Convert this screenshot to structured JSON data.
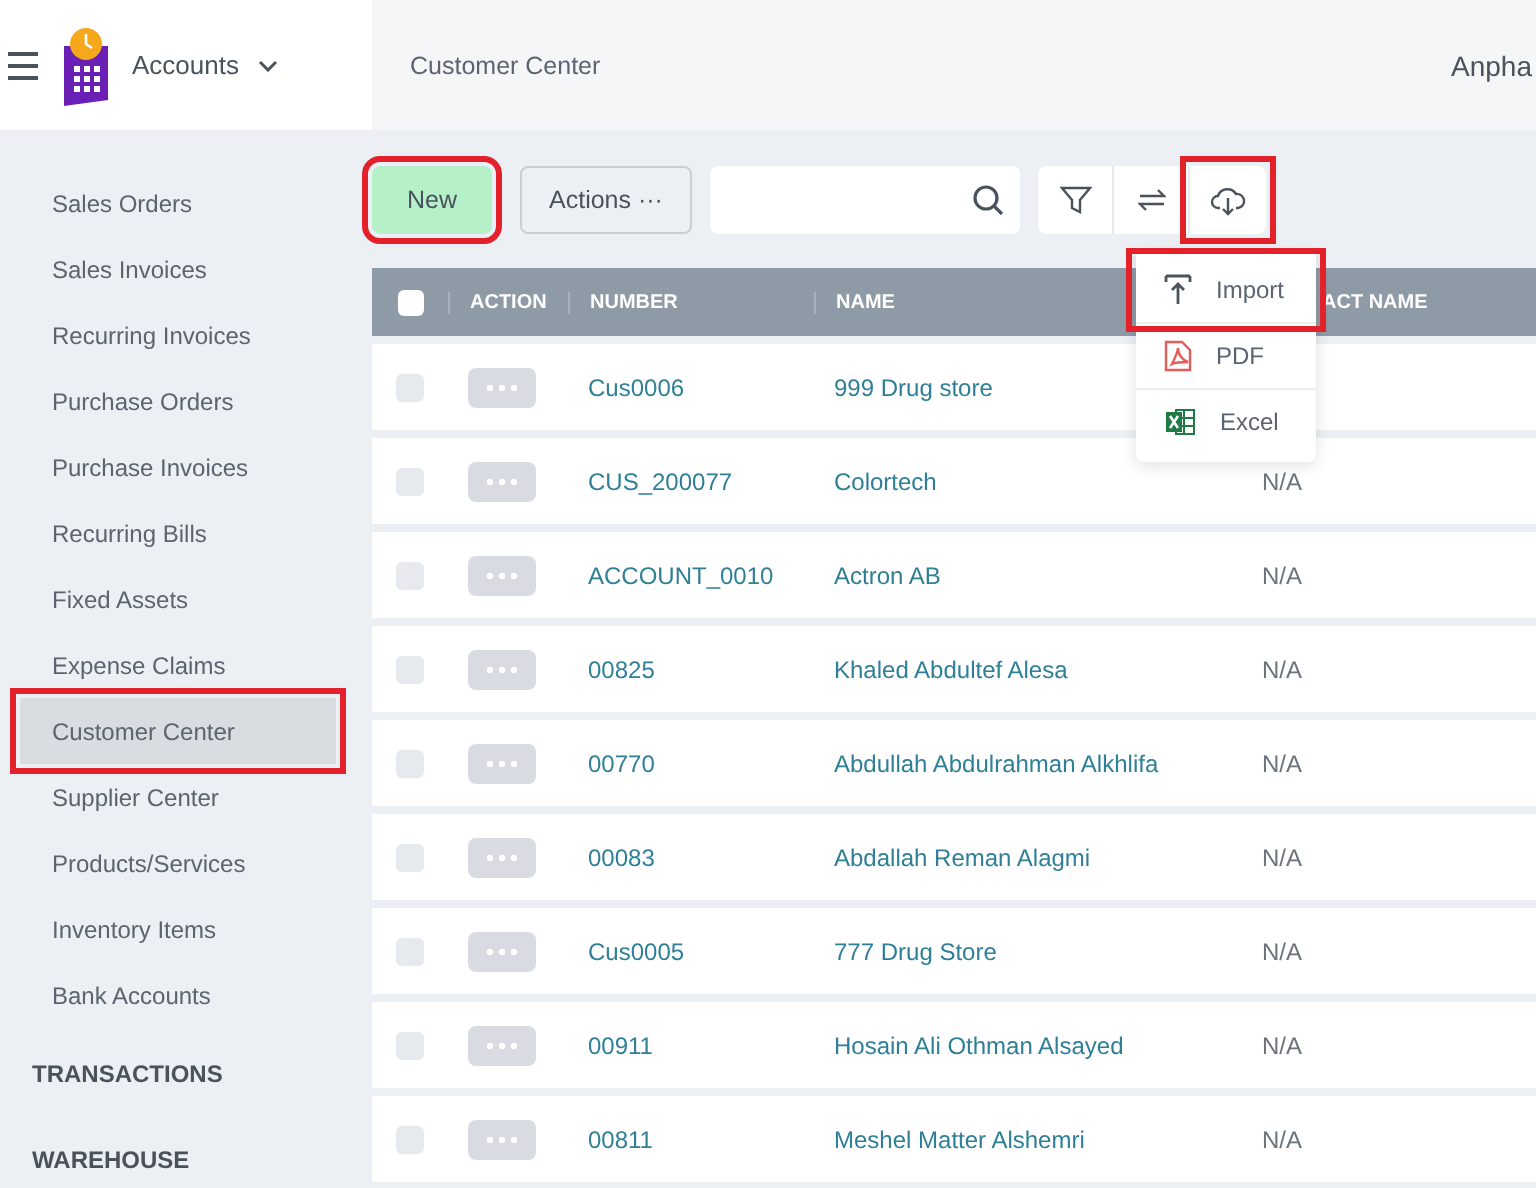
{
  "header": {
    "app_name": "Accounts",
    "page_title": "Customer Center",
    "user": "Anpha"
  },
  "sidebar": {
    "items": [
      {
        "label": "Sales Orders",
        "selected": false,
        "highlighted": false
      },
      {
        "label": "Sales Invoices",
        "selected": false,
        "highlighted": false
      },
      {
        "label": "Recurring Invoices",
        "selected": false,
        "highlighted": false
      },
      {
        "label": "Purchase Orders",
        "selected": false,
        "highlighted": false
      },
      {
        "label": "Purchase Invoices",
        "selected": false,
        "highlighted": false
      },
      {
        "label": "Recurring Bills",
        "selected": false,
        "highlighted": false
      },
      {
        "label": "Fixed Assets",
        "selected": false,
        "highlighted": false
      },
      {
        "label": "Expense Claims",
        "selected": false,
        "highlighted": false
      },
      {
        "label": "Customer Center",
        "selected": true,
        "highlighted": true
      },
      {
        "label": "Supplier Center",
        "selected": false,
        "highlighted": false
      },
      {
        "label": "Products/Services",
        "selected": false,
        "highlighted": false
      },
      {
        "label": "Inventory Items",
        "selected": false,
        "highlighted": false
      },
      {
        "label": "Bank Accounts",
        "selected": false,
        "highlighted": false
      }
    ],
    "sections": [
      "TRANSACTIONS",
      "WAREHOUSE"
    ]
  },
  "toolbar": {
    "new_button": {
      "label": "New",
      "highlighted": true
    },
    "actions_button": "Actions ···",
    "export_button": {
      "highlighted": true
    }
  },
  "export_menu": [
    {
      "kind": "import",
      "label": "Import",
      "highlighted": true
    },
    {
      "kind": "pdf",
      "label": "PDF",
      "highlighted": false
    },
    {
      "kind": "excel",
      "label": "Excel",
      "highlighted": false
    }
  ],
  "table": {
    "select_all_checked": false,
    "columns": [
      "ACTION",
      "NUMBER",
      "NAME",
      "ACT NAME"
    ],
    "rows": [
      {
        "checked": false,
        "number": "Cus0006",
        "name": "999 Drug store"
      },
      {
        "checked": false,
        "number": "CUS_200077",
        "name": "Colortech",
        "contact": "N/A"
      },
      {
        "checked": false,
        "number": "ACCOUNT_0010",
        "name": "Actron AB",
        "contact": "N/A"
      },
      {
        "checked": false,
        "number": "00825",
        "name": "Khaled Abdultef Alesa",
        "contact": "N/A"
      },
      {
        "checked": false,
        "number": "00770",
        "name": "Abdullah Abdulrahman Alkhlifa",
        "contact": "N/A"
      },
      {
        "checked": false,
        "number": "00083",
        "name": "Abdallah Reman Alagmi",
        "contact": "N/A"
      },
      {
        "checked": false,
        "number": "Cus0005",
        "name": "777 Drug Store",
        "contact": "N/A"
      },
      {
        "checked": false,
        "number": "00911",
        "name": "Hosain Ali Othman Alsayed",
        "contact": "N/A"
      },
      {
        "checked": false,
        "number": "00811",
        "name": "Meshel Matter Alshemri",
        "contact": "N/A"
      }
    ]
  }
}
